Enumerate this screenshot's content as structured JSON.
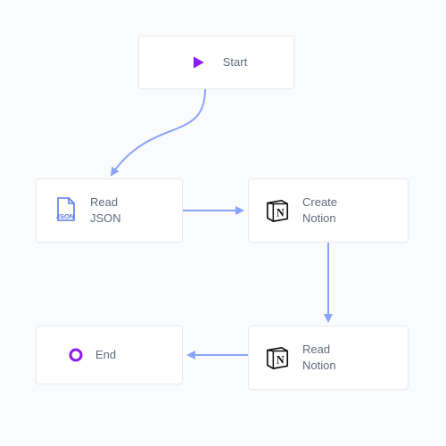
{
  "colors": {
    "connector": "#8aa4f8",
    "accent_purple": "#8b1cf0",
    "accent_blue": "#5b7ce8",
    "text": "#5f6b7a"
  },
  "nodes": {
    "start": {
      "label": "Start",
      "icon": "play-icon"
    },
    "json": {
      "label": "Read\nJSON",
      "icon": "json-file-icon"
    },
    "create": {
      "label": "Create\nNotion",
      "icon": "notion-icon"
    },
    "read": {
      "label": "Read\nNotion",
      "icon": "notion-icon"
    },
    "end": {
      "label": "End",
      "icon": "end-circle-icon"
    }
  },
  "edges": [
    {
      "from": "start",
      "to": "json"
    },
    {
      "from": "json",
      "to": "create"
    },
    {
      "from": "create",
      "to": "read"
    },
    {
      "from": "read",
      "to": "end"
    }
  ]
}
